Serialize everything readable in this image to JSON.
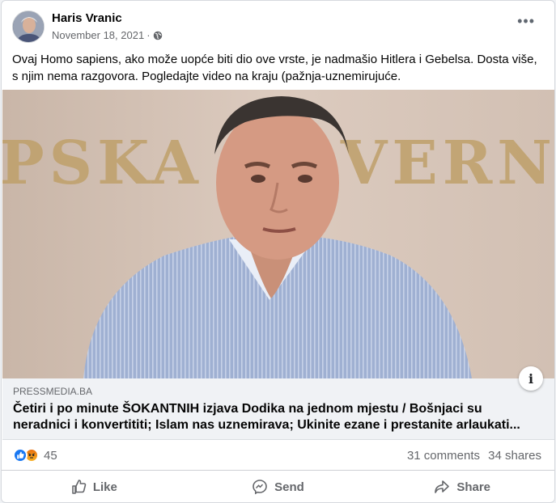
{
  "post": {
    "author": "Haris Vranic",
    "date": "November 18, 2021",
    "separator": "·",
    "privacy_icon": "globe-icon",
    "more_label": "•••",
    "text": "Ovaj Homo sapiens, ako može uopće biti dio ove vrste, je nadmašio Hitlera i Gebelsa. Dosta više, s njim nema razgovora. Pogledajte video na kraju (pažnja-uznemirujuće."
  },
  "media": {
    "background_sign": "PSKA GOVERNMENT",
    "info_label": "i"
  },
  "link": {
    "domain": "PRESSMEDIA.BA",
    "headline": "Četiri i po minute ŠOKANTNIH izjava Dodika na jednom mjestu / Bošnjaci su neradnici i konvertititi; Islam nas uznemirava; Ukinite ezane i prestanite arlaukati..."
  },
  "stats": {
    "reaction_icons": [
      "like-icon",
      "angry-icon"
    ],
    "reaction_count": "45",
    "comments": "31 comments",
    "shares": "34 shares"
  },
  "actions": {
    "like": "Like",
    "send": "Send",
    "share": "Share"
  },
  "colors": {
    "like_blue": "#1877f2",
    "angry_orange": "#e9710f",
    "secondary_text": "#65676b",
    "link_box_bg": "#f0f2f5"
  }
}
